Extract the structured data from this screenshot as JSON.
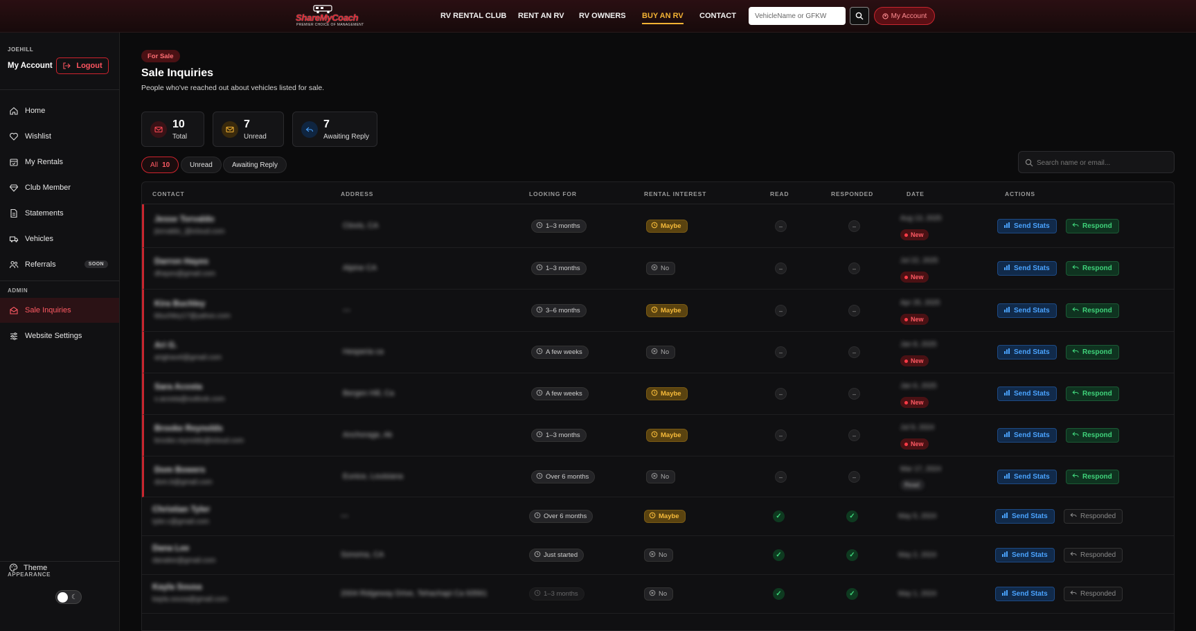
{
  "nav": {
    "logo_text": "ShareMyCoach",
    "logo_tagline": "PREMIER CHOICE OF MANAGEMENT",
    "links": [
      "RV RENTAL CLUB",
      "RENT AN RV",
      "RV OWNERS",
      "BUY AN RV",
      "CONTACT"
    ],
    "active_link": "BUY AN RV",
    "search_placeholder": "VehicleName or GFKW",
    "account_label": "My Account"
  },
  "sidebar": {
    "username": "JOEHILL",
    "my_account": "My Account",
    "logout": "Logout",
    "items": [
      {
        "label": "Home",
        "icon": "home-icon"
      },
      {
        "label": "Wishlist",
        "icon": "heart-icon"
      },
      {
        "label": "My Rentals",
        "icon": "calendar-icon"
      },
      {
        "label": "Club Member",
        "icon": "diamond-icon"
      },
      {
        "label": "Statements",
        "icon": "document-icon"
      },
      {
        "label": "Vehicles",
        "icon": "truck-icon"
      },
      {
        "label": "Referrals",
        "icon": "users-icon",
        "badge": "SOON"
      }
    ],
    "admin_label": "ADMIN",
    "admin_items": [
      {
        "label": "Sale Inquiries",
        "icon": "envelope-icon",
        "active": true
      },
      {
        "label": "Website Settings",
        "icon": "sliders-icon"
      }
    ],
    "appearance_label": "APPEARANCE",
    "theme_label": "Theme"
  },
  "page": {
    "badge": "For Sale",
    "title": "Sale Inquiries",
    "subtitle": "People who've reached out about vehicles listed for sale."
  },
  "stats": [
    {
      "value": "10",
      "label": "Total",
      "icon": "mail-icon",
      "color": "#ff4a55",
      "bg": "#3a1216"
    },
    {
      "value": "7",
      "label": "Unread",
      "icon": "mail-icon",
      "color": "#f3b234",
      "bg": "#3a2a0c"
    },
    {
      "value": "7",
      "label": "Awaiting Reply",
      "icon": "reply-icon",
      "color": "#4aa3ff",
      "bg": "#0f2540"
    }
  ],
  "filters": [
    {
      "label": "All",
      "count": "10",
      "active": true
    },
    {
      "label": "Unread",
      "count": ""
    },
    {
      "label": "Awaiting Reply",
      "count": ""
    }
  ],
  "table_search_placeholder": "Search name or email...",
  "columns": [
    "CONTACT",
    "ADDRESS",
    "LOOKING FOR",
    "RENTAL INTEREST",
    "READ",
    "RESPONDED",
    "DATE",
    "ACTIONS"
  ],
  "actions": {
    "send_stats": "Send Stats",
    "respond": "Respond",
    "responded": "Responded",
    "new": "New",
    "read_badge": "Read",
    "dash": "–",
    "check": "✓"
  },
  "rows": [
    {
      "name": "Jesse Torvaldo",
      "email": "jtorvaldo_@icloud.com",
      "address": "Clovis, CA",
      "looking_for": "1–3 months",
      "interest": "Maybe",
      "read": false,
      "responded": false,
      "date": "Aug 13, 2025",
      "status": "new"
    },
    {
      "name": "Darron Hayes",
      "email": "dhayes@gmail.com",
      "address": "Alpine CA",
      "looking_for": "1–3 months",
      "interest": "No",
      "read": false,
      "responded": false,
      "date": "Jul 22, 2025",
      "status": "new"
    },
    {
      "name": "Kira Buchley",
      "email": "kbuchley17@yahoo.com",
      "address": "—",
      "looking_for": "3–6 months",
      "interest": "Maybe",
      "read": false,
      "responded": false,
      "date": "Apr 25, 2025",
      "status": "new"
    },
    {
      "name": "Ari G.",
      "email": "arigtravel@gmail.com",
      "address": "Hesperia ca",
      "looking_for": "A few weeks",
      "interest": "No",
      "read": false,
      "responded": false,
      "date": "Jan 8, 2025",
      "status": "new"
    },
    {
      "name": "Sara Acosta",
      "email": "s.acosta@outlook.com",
      "address": "Bergen Hill, Ca",
      "looking_for": "A few weeks",
      "interest": "Maybe",
      "read": false,
      "responded": false,
      "date": "Jan 6, 2025",
      "status": "new"
    },
    {
      "name": "Brooke Reynolds",
      "email": "brooke.reynolds@icloud.com",
      "address": "Anchorage, Ak",
      "looking_for": "1–3 months",
      "interest": "Maybe",
      "read": false,
      "responded": false,
      "date": "Jul 9, 2024",
      "status": "new"
    },
    {
      "name": "Dom Bowers",
      "email": "dom.b@gmail.com",
      "address": "Eunice, Louisiana",
      "looking_for": "Over 6 months",
      "interest": "No",
      "read": false,
      "responded": false,
      "date": "Mar 17, 2024",
      "status": "read"
    },
    {
      "name": "Christian Tyler",
      "email": "tyler.c@gmail.com",
      "address": "—",
      "looking_for": "Over 6 months",
      "interest": "Maybe",
      "read": true,
      "responded": true,
      "date": "May 5, 2024",
      "status": ""
    },
    {
      "name": "Dana Lee",
      "email": "danalee@gmail.com",
      "address": "Sonoma, CA",
      "looking_for": "Just started",
      "interest": "No",
      "read": true,
      "responded": true,
      "date": "May 2, 2024",
      "status": ""
    },
    {
      "name": "Kayla Sousa",
      "email": "kayla.sousa@gmail.com",
      "address": "2004 Ridgeway Drive, Tehachapi Ca 93561",
      "looking_for": "1–3 months",
      "interest": "No",
      "read": true,
      "responded": true,
      "date": "May 1, 2024",
      "status": ""
    }
  ]
}
